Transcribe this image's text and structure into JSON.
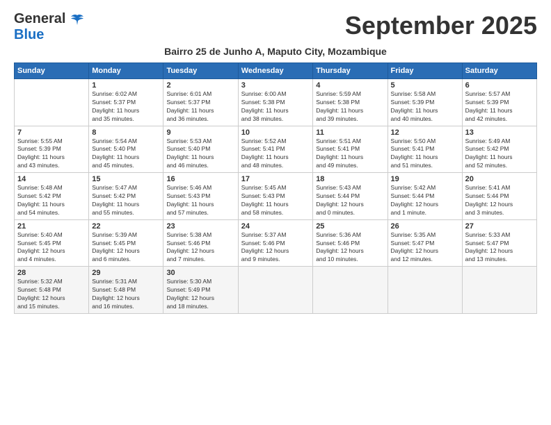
{
  "header": {
    "logo_general": "General",
    "logo_blue": "Blue",
    "month_title": "September 2025",
    "subtitle": "Bairro 25 de Junho A, Maputo City, Mozambique"
  },
  "days_of_week": [
    "Sunday",
    "Monday",
    "Tuesday",
    "Wednesday",
    "Thursday",
    "Friday",
    "Saturday"
  ],
  "weeks": [
    [
      {
        "day": "",
        "info": ""
      },
      {
        "day": "1",
        "info": "Sunrise: 6:02 AM\nSunset: 5:37 PM\nDaylight: 11 hours\nand 35 minutes."
      },
      {
        "day": "2",
        "info": "Sunrise: 6:01 AM\nSunset: 5:37 PM\nDaylight: 11 hours\nand 36 minutes."
      },
      {
        "day": "3",
        "info": "Sunrise: 6:00 AM\nSunset: 5:38 PM\nDaylight: 11 hours\nand 38 minutes."
      },
      {
        "day": "4",
        "info": "Sunrise: 5:59 AM\nSunset: 5:38 PM\nDaylight: 11 hours\nand 39 minutes."
      },
      {
        "day": "5",
        "info": "Sunrise: 5:58 AM\nSunset: 5:39 PM\nDaylight: 11 hours\nand 40 minutes."
      },
      {
        "day": "6",
        "info": "Sunrise: 5:57 AM\nSunset: 5:39 PM\nDaylight: 11 hours\nand 42 minutes."
      }
    ],
    [
      {
        "day": "7",
        "info": "Sunrise: 5:55 AM\nSunset: 5:39 PM\nDaylight: 11 hours\nand 43 minutes."
      },
      {
        "day": "8",
        "info": "Sunrise: 5:54 AM\nSunset: 5:40 PM\nDaylight: 11 hours\nand 45 minutes."
      },
      {
        "day": "9",
        "info": "Sunrise: 5:53 AM\nSunset: 5:40 PM\nDaylight: 11 hours\nand 46 minutes."
      },
      {
        "day": "10",
        "info": "Sunrise: 5:52 AM\nSunset: 5:41 PM\nDaylight: 11 hours\nand 48 minutes."
      },
      {
        "day": "11",
        "info": "Sunrise: 5:51 AM\nSunset: 5:41 PM\nDaylight: 11 hours\nand 49 minutes."
      },
      {
        "day": "12",
        "info": "Sunrise: 5:50 AM\nSunset: 5:41 PM\nDaylight: 11 hours\nand 51 minutes."
      },
      {
        "day": "13",
        "info": "Sunrise: 5:49 AM\nSunset: 5:42 PM\nDaylight: 11 hours\nand 52 minutes."
      }
    ],
    [
      {
        "day": "14",
        "info": "Sunrise: 5:48 AM\nSunset: 5:42 PM\nDaylight: 11 hours\nand 54 minutes."
      },
      {
        "day": "15",
        "info": "Sunrise: 5:47 AM\nSunset: 5:42 PM\nDaylight: 11 hours\nand 55 minutes."
      },
      {
        "day": "16",
        "info": "Sunrise: 5:46 AM\nSunset: 5:43 PM\nDaylight: 11 hours\nand 57 minutes."
      },
      {
        "day": "17",
        "info": "Sunrise: 5:45 AM\nSunset: 5:43 PM\nDaylight: 11 hours\nand 58 minutes."
      },
      {
        "day": "18",
        "info": "Sunrise: 5:43 AM\nSunset: 5:44 PM\nDaylight: 12 hours\nand 0 minutes."
      },
      {
        "day": "19",
        "info": "Sunrise: 5:42 AM\nSunset: 5:44 PM\nDaylight: 12 hours\nand 1 minute."
      },
      {
        "day": "20",
        "info": "Sunrise: 5:41 AM\nSunset: 5:44 PM\nDaylight: 12 hours\nand 3 minutes."
      }
    ],
    [
      {
        "day": "21",
        "info": "Sunrise: 5:40 AM\nSunset: 5:45 PM\nDaylight: 12 hours\nand 4 minutes."
      },
      {
        "day": "22",
        "info": "Sunrise: 5:39 AM\nSunset: 5:45 PM\nDaylight: 12 hours\nand 6 minutes."
      },
      {
        "day": "23",
        "info": "Sunrise: 5:38 AM\nSunset: 5:46 PM\nDaylight: 12 hours\nand 7 minutes."
      },
      {
        "day": "24",
        "info": "Sunrise: 5:37 AM\nSunset: 5:46 PM\nDaylight: 12 hours\nand 9 minutes."
      },
      {
        "day": "25",
        "info": "Sunrise: 5:36 AM\nSunset: 5:46 PM\nDaylight: 12 hours\nand 10 minutes."
      },
      {
        "day": "26",
        "info": "Sunrise: 5:35 AM\nSunset: 5:47 PM\nDaylight: 12 hours\nand 12 minutes."
      },
      {
        "day": "27",
        "info": "Sunrise: 5:33 AM\nSunset: 5:47 PM\nDaylight: 12 hours\nand 13 minutes."
      }
    ],
    [
      {
        "day": "28",
        "info": "Sunrise: 5:32 AM\nSunset: 5:48 PM\nDaylight: 12 hours\nand 15 minutes."
      },
      {
        "day": "29",
        "info": "Sunrise: 5:31 AM\nSunset: 5:48 PM\nDaylight: 12 hours\nand 16 minutes."
      },
      {
        "day": "30",
        "info": "Sunrise: 5:30 AM\nSunset: 5:49 PM\nDaylight: 12 hours\nand 18 minutes."
      },
      {
        "day": "",
        "info": ""
      },
      {
        "day": "",
        "info": ""
      },
      {
        "day": "",
        "info": ""
      },
      {
        "day": "",
        "info": ""
      }
    ]
  ]
}
